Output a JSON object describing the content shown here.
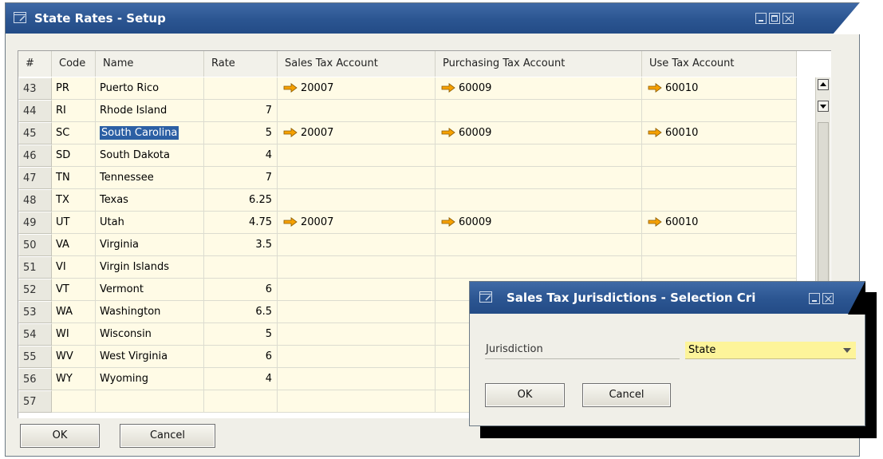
{
  "main_window": {
    "title": "State Rates - Setup",
    "columns": [
      "#",
      "Code",
      "Name",
      "Rate",
      "Sales Tax Account",
      "Purchasing Tax Account",
      "Use Tax Account"
    ],
    "rows": [
      {
        "num": "43",
        "code": "PR",
        "name": "Puerto Rico",
        "rate": "",
        "sales": "20007",
        "purchasing": "60009",
        "use": "60010"
      },
      {
        "num": "44",
        "code": "RI",
        "name": "Rhode Island",
        "rate": "7",
        "sales": "",
        "purchasing": "",
        "use": ""
      },
      {
        "num": "45",
        "code": "SC",
        "name": "South Carolina",
        "rate": "5",
        "sales": "20007",
        "purchasing": "60009",
        "use": "60010"
      },
      {
        "num": "46",
        "code": "SD",
        "name": "South Dakota",
        "rate": "4",
        "sales": "",
        "purchasing": "",
        "use": ""
      },
      {
        "num": "47",
        "code": "TN",
        "name": "Tennessee",
        "rate": "7",
        "sales": "",
        "purchasing": "",
        "use": ""
      },
      {
        "num": "48",
        "code": "TX",
        "name": "Texas",
        "rate": "6.25",
        "sales": "",
        "purchasing": "",
        "use": ""
      },
      {
        "num": "49",
        "code": "UT",
        "name": "Utah",
        "rate": "4.75",
        "sales": "20007",
        "purchasing": "60009",
        "use": "60010"
      },
      {
        "num": "50",
        "code": "VA",
        "name": "Virginia",
        "rate": "3.5",
        "sales": "",
        "purchasing": "",
        "use": ""
      },
      {
        "num": "51",
        "code": "VI",
        "name": "Virgin Islands",
        "rate": "",
        "sales": "",
        "purchasing": "",
        "use": ""
      },
      {
        "num": "52",
        "code": "VT",
        "name": "Vermont",
        "rate": "6",
        "sales": "",
        "purchasing": "",
        "use": ""
      },
      {
        "num": "53",
        "code": "WA",
        "name": "Washington",
        "rate": "6.5",
        "sales": "",
        "purchasing": "",
        "use": ""
      },
      {
        "num": "54",
        "code": "WI",
        "name": "Wisconsin",
        "rate": "5",
        "sales": "",
        "purchasing": "",
        "use": ""
      },
      {
        "num": "55",
        "code": "WV",
        "name": "West Virginia",
        "rate": "6",
        "sales": "",
        "purchasing": "",
        "use": ""
      },
      {
        "num": "56",
        "code": "WY",
        "name": "Wyoming",
        "rate": "4",
        "sales": "",
        "purchasing": "",
        "use": ""
      },
      {
        "num": "57",
        "code": "",
        "name": "",
        "rate": "",
        "sales": "",
        "purchasing": "",
        "use": ""
      }
    ],
    "selected_row": "45",
    "ok_label": "OK",
    "cancel_label": "Cancel"
  },
  "dialog": {
    "title": "Sales Tax Jurisdictions - Selection Cri",
    "field_label": "Jurisdiction",
    "field_value": "State",
    "ok_label": "OK",
    "cancel_label": "Cancel"
  },
  "colors": {
    "titlebar": "#2b5591",
    "grid_cell": "#fffbe6",
    "selection": "#2b5fa4",
    "dropdown_field": "#fdf49a",
    "link_arrow": "#f5a000"
  }
}
